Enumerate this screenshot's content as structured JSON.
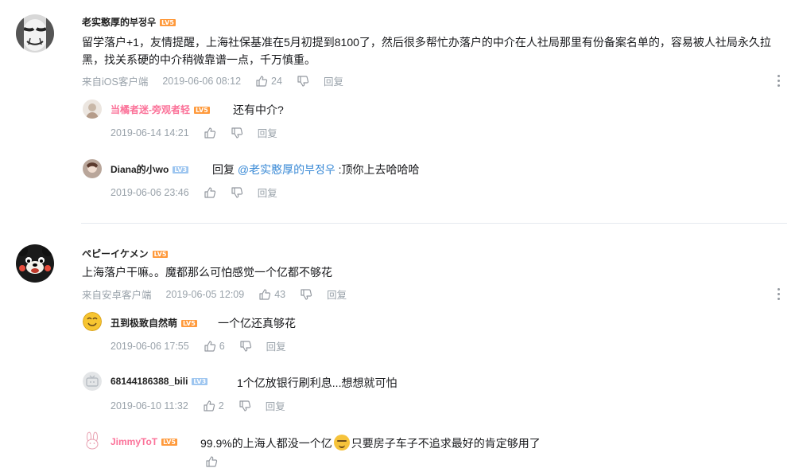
{
  "comments": [
    {
      "username": "老实憨厚的부정우",
      "level": "LV5",
      "content": "留学落户+1，友情提醒，上海社保基准在5月初提到8100了，然后很多帮忙办落户的中介在人社局那里有份备案名单的，容易被人社局永久拉黑，找关系硬的中介稍微靠谱一点，千万慎重。",
      "source": "来自iOS客户端",
      "time": "2019-06-06 08:12",
      "likes": "24",
      "reply_label": "回复",
      "replies": [
        {
          "username": "当橘者迷-旁观者轻",
          "level": "LV5",
          "text": "还有中介?",
          "time": "2019-06-14 14:21",
          "likes": "",
          "reply_label": "回复"
        },
        {
          "username": "Diana的小wo",
          "level": "LV3",
          "prefix": "回复",
          "mention": "@老实憨厚的부정우",
          "text": " :顶你上去哈哈哈",
          "time": "2019-06-06 23:46",
          "likes": "",
          "reply_label": "回复"
        }
      ]
    },
    {
      "username": "ペピーイケメン",
      "level": "LV5",
      "content": "上海落户干嘛。。魔都那么可怕感觉一个亿都不够花",
      "source": "来自安卓客户端",
      "time": "2019-06-05 12:09",
      "likes": "43",
      "reply_label": "回复",
      "replies": [
        {
          "username": "丑到极致自然萌",
          "level": "LV5",
          "text": "一个亿还真够花",
          "time": "2019-06-06 17:55",
          "likes": "6",
          "reply_label": "回复"
        },
        {
          "username": "68144186388_bili",
          "level": "LV3",
          "text": "1个亿放银行刷利息...想想就可怕",
          "time": "2019-06-10 11:32",
          "likes": "2",
          "reply_label": "回复"
        },
        {
          "username": "JimmyToT",
          "level": "LV5",
          "text_before": "99.9%的上海人都没一个亿",
          "text_after": "只要房子车子不追求最好的肯定够用了"
        }
      ]
    }
  ],
  "colors": {
    "link": "#3a8ad6",
    "pink_name": "#fb7299",
    "meta": "#99a2aa",
    "level5": "#ff9a3c",
    "level3": "#9ec6f0"
  }
}
